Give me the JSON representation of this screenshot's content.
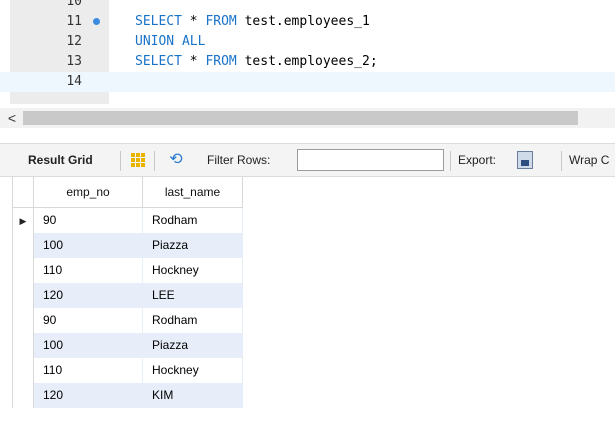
{
  "editor": {
    "lines": [
      {
        "num": "10",
        "tokens": []
      },
      {
        "num": "11",
        "tokens": [
          {
            "t": "SELECT",
            "k": true
          },
          {
            "t": " * ",
            "k": false
          },
          {
            "t": "FROM",
            "k": true
          },
          {
            "t": " test.employees_1",
            "k": false
          }
        ],
        "marker": true
      },
      {
        "num": "12",
        "tokens": [
          {
            "t": "UNION ALL",
            "k": true
          }
        ]
      },
      {
        "num": "13",
        "tokens": [
          {
            "t": "SELECT",
            "k": true
          },
          {
            "t": " * ",
            "k": false
          },
          {
            "t": "FROM",
            "k": true
          },
          {
            "t": " test.employees_2;",
            "k": false
          }
        ]
      },
      {
        "num": "14",
        "tokens": [],
        "current": true
      }
    ]
  },
  "scrollbar": {
    "left_arrow": "<"
  },
  "toolbar": {
    "result_grid_label": "Result Grid",
    "filter_label": "Filter Rows:",
    "filter_value": "",
    "export_label": "Export:",
    "wrap_label": "Wrap C",
    "icons": [
      "grid-icon",
      "refresh-icon",
      "export-icon"
    ],
    "accent_grid_icon": "#e9b400"
  },
  "result": {
    "columns": [
      "emp_no",
      "last_name"
    ],
    "rows": [
      {
        "emp_no": "90",
        "last_name": "Rodham"
      },
      {
        "emp_no": "100",
        "last_name": "Piazza"
      },
      {
        "emp_no": "110",
        "last_name": "Hockney"
      },
      {
        "emp_no": "120",
        "last_name": "LEE"
      },
      {
        "emp_no": "90",
        "last_name": "Rodham"
      },
      {
        "emp_no": "100",
        "last_name": "Piazza"
      },
      {
        "emp_no": "110",
        "last_name": "Hockney"
      },
      {
        "emp_no": "120",
        "last_name": "KIM"
      }
    ],
    "current_row_marker": "▶",
    "colors": {
      "keyword": "#1a73c9",
      "alt_row": "#e8eef9"
    }
  }
}
